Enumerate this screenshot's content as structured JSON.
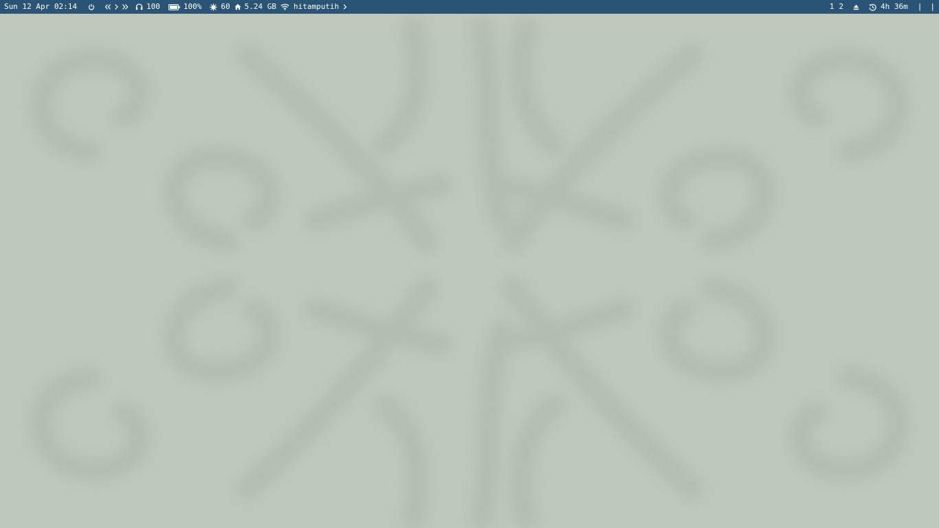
{
  "colors": {
    "bar_background": "#2a5476",
    "bar_text": "#ffffff",
    "desktop_background": "#bec8bc",
    "wallpaper_pattern": "#b3bdb1"
  },
  "bar": {
    "left": {
      "datetime": "Sun 12 Apr 02:14",
      "power_icon": "power-icon",
      "media": {
        "prev_icon": "rewind-icon",
        "play_icon": "play-icon",
        "next_icon": "fast-forward-icon"
      },
      "volume": {
        "icon": "headphones-icon",
        "value": "100"
      },
      "battery": {
        "icon": "battery-icon",
        "value": "100%",
        "level": 1.0
      },
      "brightness": {
        "icon": "brightness-icon",
        "value": "60"
      },
      "disk": {
        "icon": "home-icon",
        "value": "5.24 GB"
      },
      "network": {
        "icon": "wifi-icon",
        "ssid": "hitamputih",
        "chevron_icon": "chevron-right-icon"
      }
    },
    "right": {
      "workspaces": [
        "1",
        "2"
      ],
      "eject_icon": "eject-icon",
      "uptime": {
        "icon": "history-icon",
        "value": "4h 36m"
      },
      "separators": [
        "|",
        "|"
      ]
    }
  }
}
